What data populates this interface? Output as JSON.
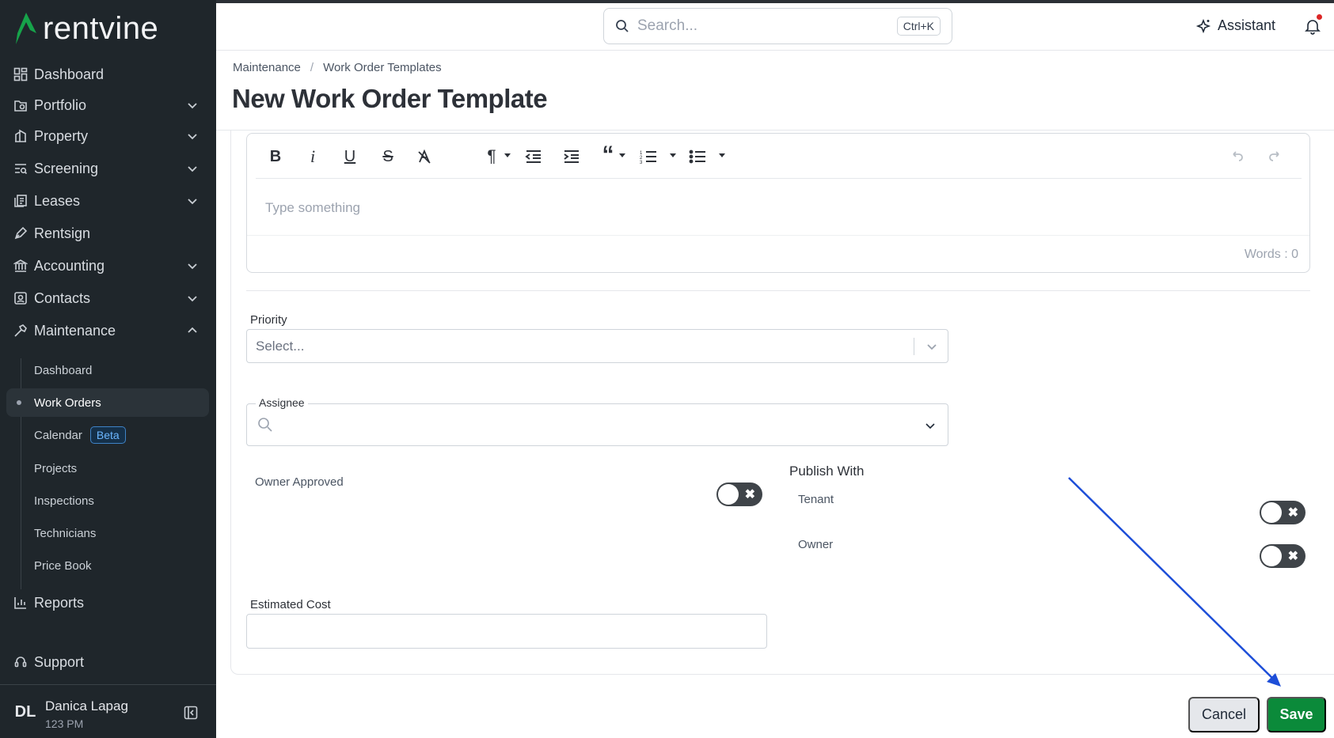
{
  "app": {
    "brand": "rentvine",
    "brand_color": "#16a34a"
  },
  "sidebar": {
    "items": [
      {
        "label": "Dashboard",
        "icon": "dashboard-icon"
      },
      {
        "label": "Portfolio",
        "icon": "portfolio-icon"
      },
      {
        "label": "Property",
        "icon": "building-icon"
      },
      {
        "label": "Screening",
        "icon": "screening-icon"
      },
      {
        "label": "Leases",
        "icon": "leases-icon"
      },
      {
        "label": "Rentsign",
        "icon": "pen-icon"
      },
      {
        "label": "Accounting",
        "icon": "bank-icon"
      },
      {
        "label": "Contacts",
        "icon": "contacts-icon"
      },
      {
        "label": "Maintenance",
        "icon": "hammer-icon"
      },
      {
        "label": "Reports",
        "icon": "bar-chart-icon"
      },
      {
        "label": "Support",
        "icon": "support-icon"
      }
    ],
    "maintenance_sub": [
      {
        "label": "Dashboard"
      },
      {
        "label": "Work Orders"
      },
      {
        "label": "Calendar",
        "badge": "Beta"
      },
      {
        "label": "Projects"
      },
      {
        "label": "Inspections"
      },
      {
        "label": "Technicians"
      },
      {
        "label": "Price Book"
      }
    ],
    "user": {
      "initials": "DL",
      "name": "Danica Lapag",
      "sub": "123 PM"
    }
  },
  "header": {
    "search_placeholder": "Search...",
    "search_shortcut": "Ctrl+K",
    "assistant_label": "Assistant"
  },
  "breadcrumb": {
    "parent": "Maintenance",
    "separator": "/",
    "current": "Work Order Templates"
  },
  "page_title": "New Work Order Template",
  "editor": {
    "placeholder": "Type something",
    "word_count": "Words : 0"
  },
  "form": {
    "priority_label": "Priority",
    "priority_placeholder": "Select...",
    "assignee_label": "Assignee",
    "owner_approved_label": "Owner Approved",
    "owner_approved": false,
    "publish_with_label": "Publish With",
    "tenant_label": "Tenant",
    "tenant": false,
    "owner_label": "Owner",
    "owner": false,
    "estimated_cost_label": "Estimated Cost",
    "estimated_cost_value": ""
  },
  "actions": {
    "cancel_label": "Cancel",
    "save_label": "Save"
  },
  "annotation": {
    "arrow_color": "#1d4ed8"
  }
}
